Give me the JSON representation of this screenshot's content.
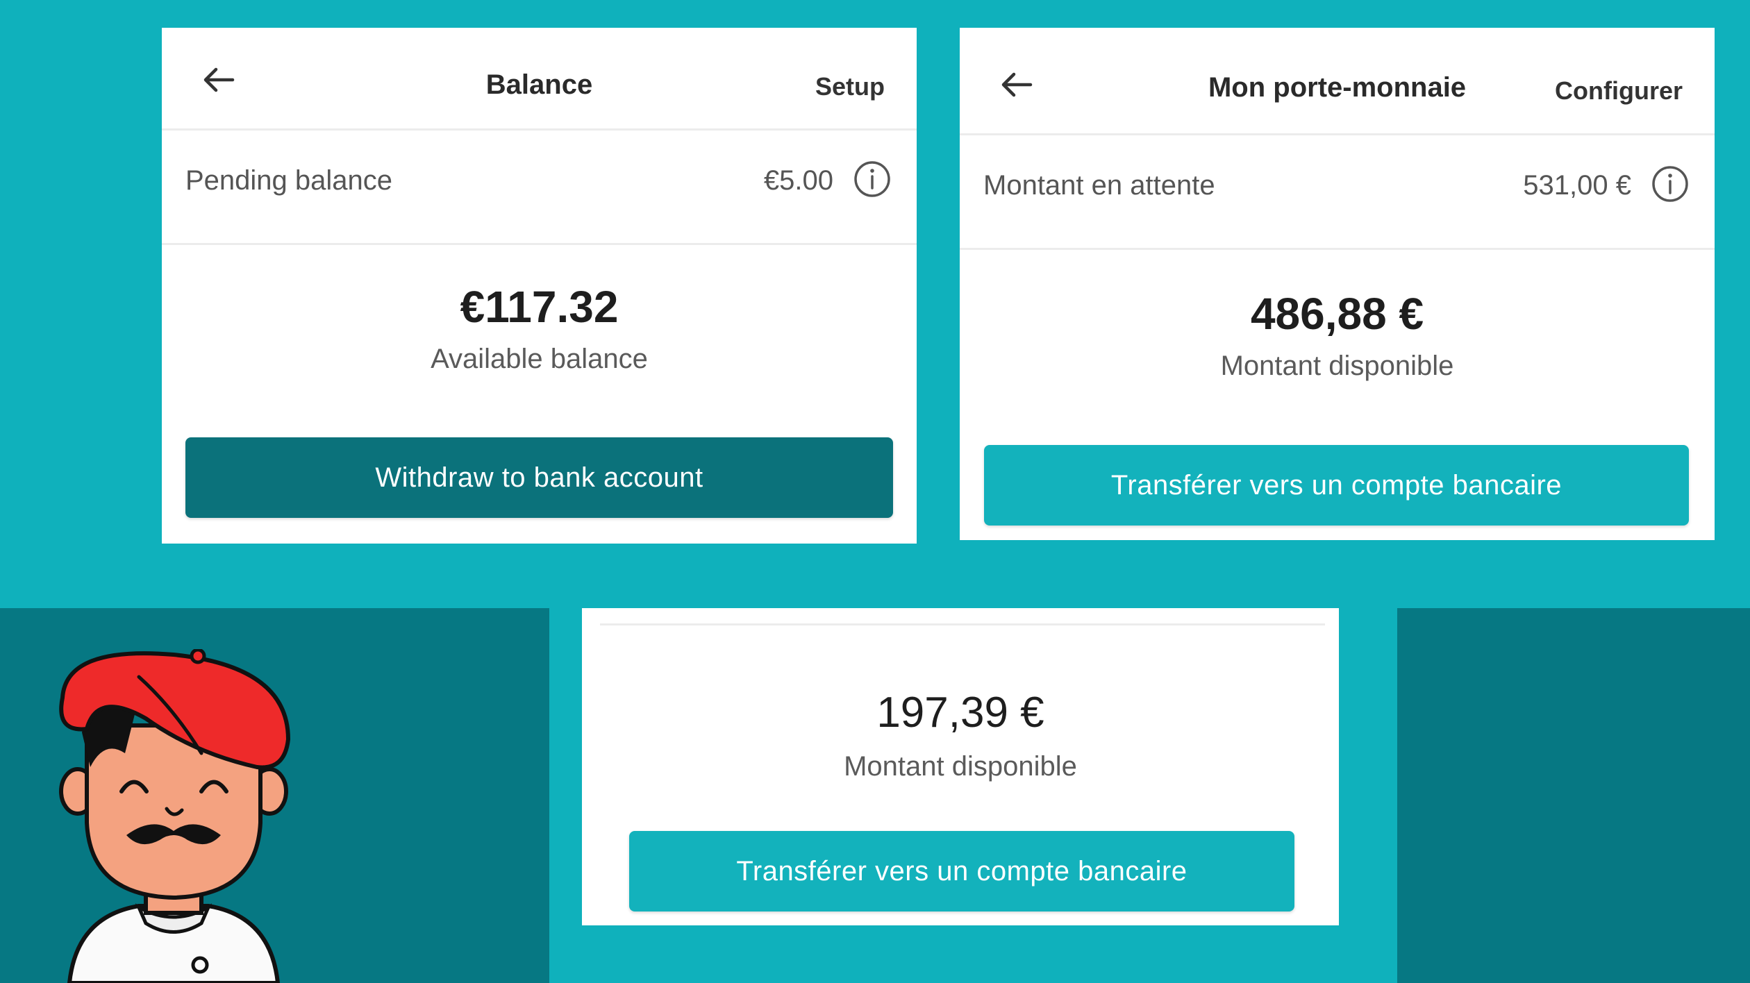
{
  "screens": [
    {
      "title": "Balance",
      "action": "Setup",
      "pending_label": "Pending balance",
      "pending_value": "€5.00",
      "amount": "€117.32",
      "amount_label": "Available balance",
      "button": "Withdraw to bank account"
    },
    {
      "title": "Mon porte-monnaie",
      "action": "Configurer",
      "pending_label": "Montant en attente",
      "pending_value": "531,00 €",
      "amount": "486,88 €",
      "amount_label": "Montant disponible",
      "button": "Transférer vers un compte bancaire"
    },
    {
      "amount": "197,39 €",
      "amount_label": "Montant disponible",
      "button": "Transférer vers un compte bancaire"
    }
  ],
  "colors": {
    "background": "#0fb1bc",
    "band": "#067883",
    "button_dark": "#0b727b",
    "button_teal": "#13b2bc"
  },
  "icons": [
    "back-arrow-icon",
    "info-icon",
    "chef-illustration"
  ]
}
